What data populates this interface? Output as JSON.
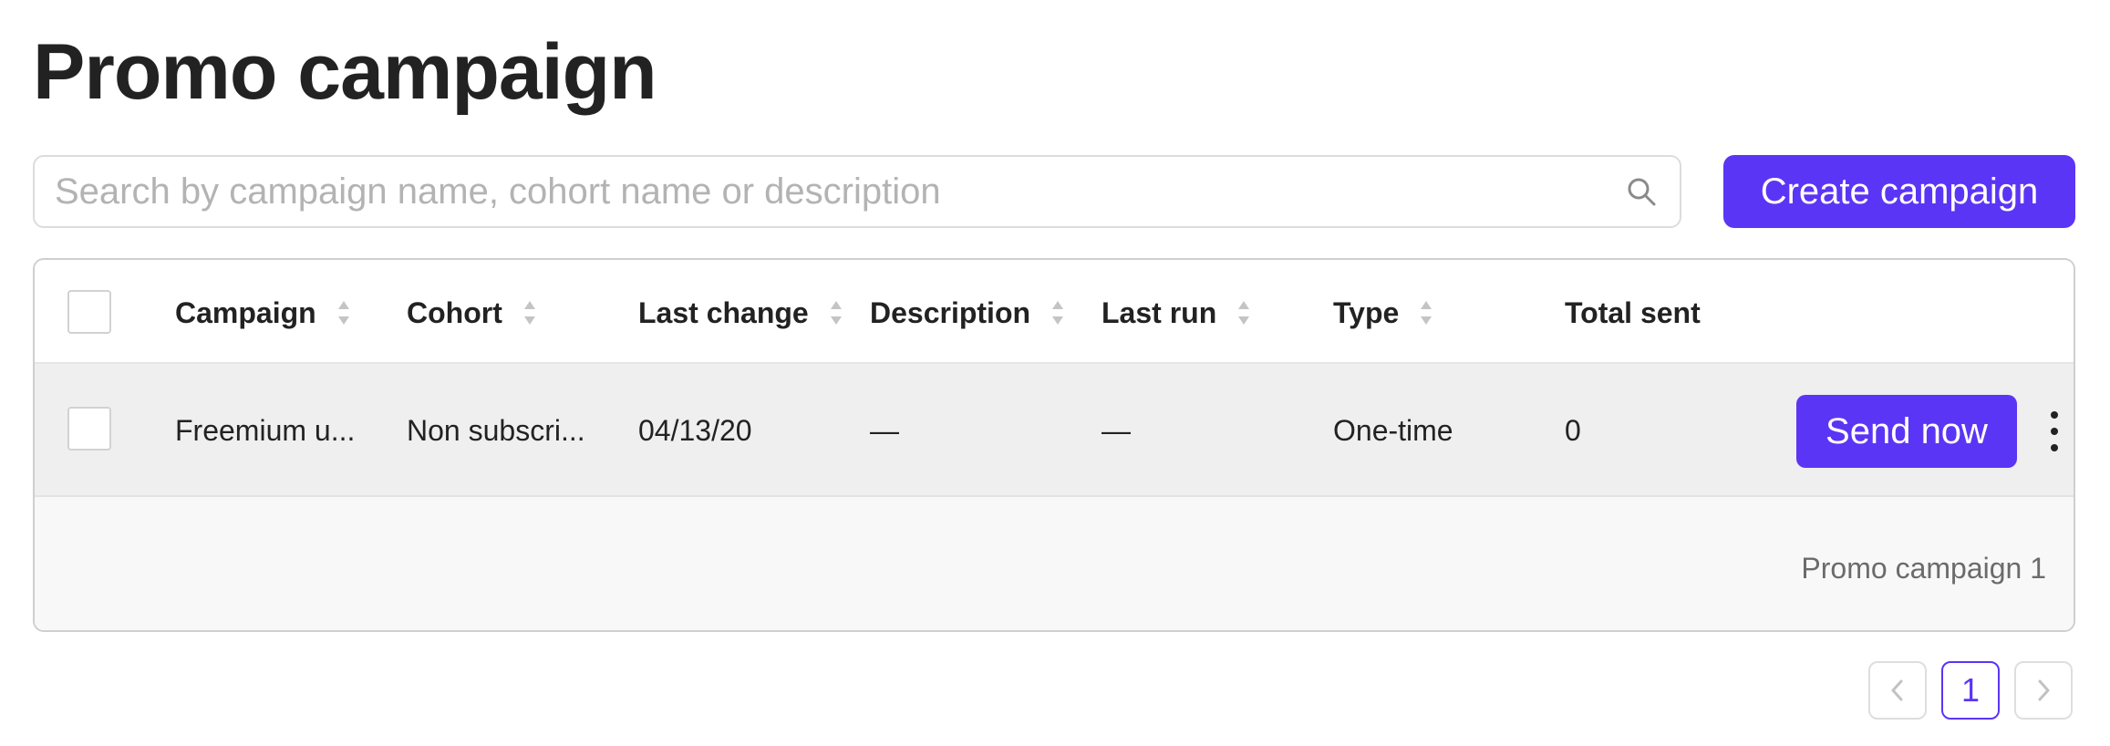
{
  "page": {
    "title": "Promo campaign"
  },
  "search": {
    "placeholder": "Search by campaign name, cohort name or description",
    "value": ""
  },
  "actions": {
    "create_label": "Create campaign",
    "accent_color": "#5b35f5"
  },
  "table": {
    "columns": [
      {
        "label": "Campaign",
        "sortable": true
      },
      {
        "label": "Cohort",
        "sortable": true
      },
      {
        "label": "Last change",
        "sortable": true
      },
      {
        "label": "Description",
        "sortable": true
      },
      {
        "label": "Last run",
        "sortable": true
      },
      {
        "label": "Type",
        "sortable": true
      },
      {
        "label": "Total sent",
        "sortable": false
      }
    ],
    "rows": [
      {
        "campaign": "Freemium u...",
        "cohort": "Non subscri...",
        "last_change": "04/13/20",
        "description": "—",
        "last_run": "—",
        "type": "One-time",
        "total_sent": "0",
        "action_label": "Send now"
      }
    ],
    "footer_label": "Promo campaign 1"
  },
  "pagination": {
    "current_page": "1",
    "prev_icon": "chevron-left-icon",
    "next_icon": "chevron-right-icon"
  }
}
